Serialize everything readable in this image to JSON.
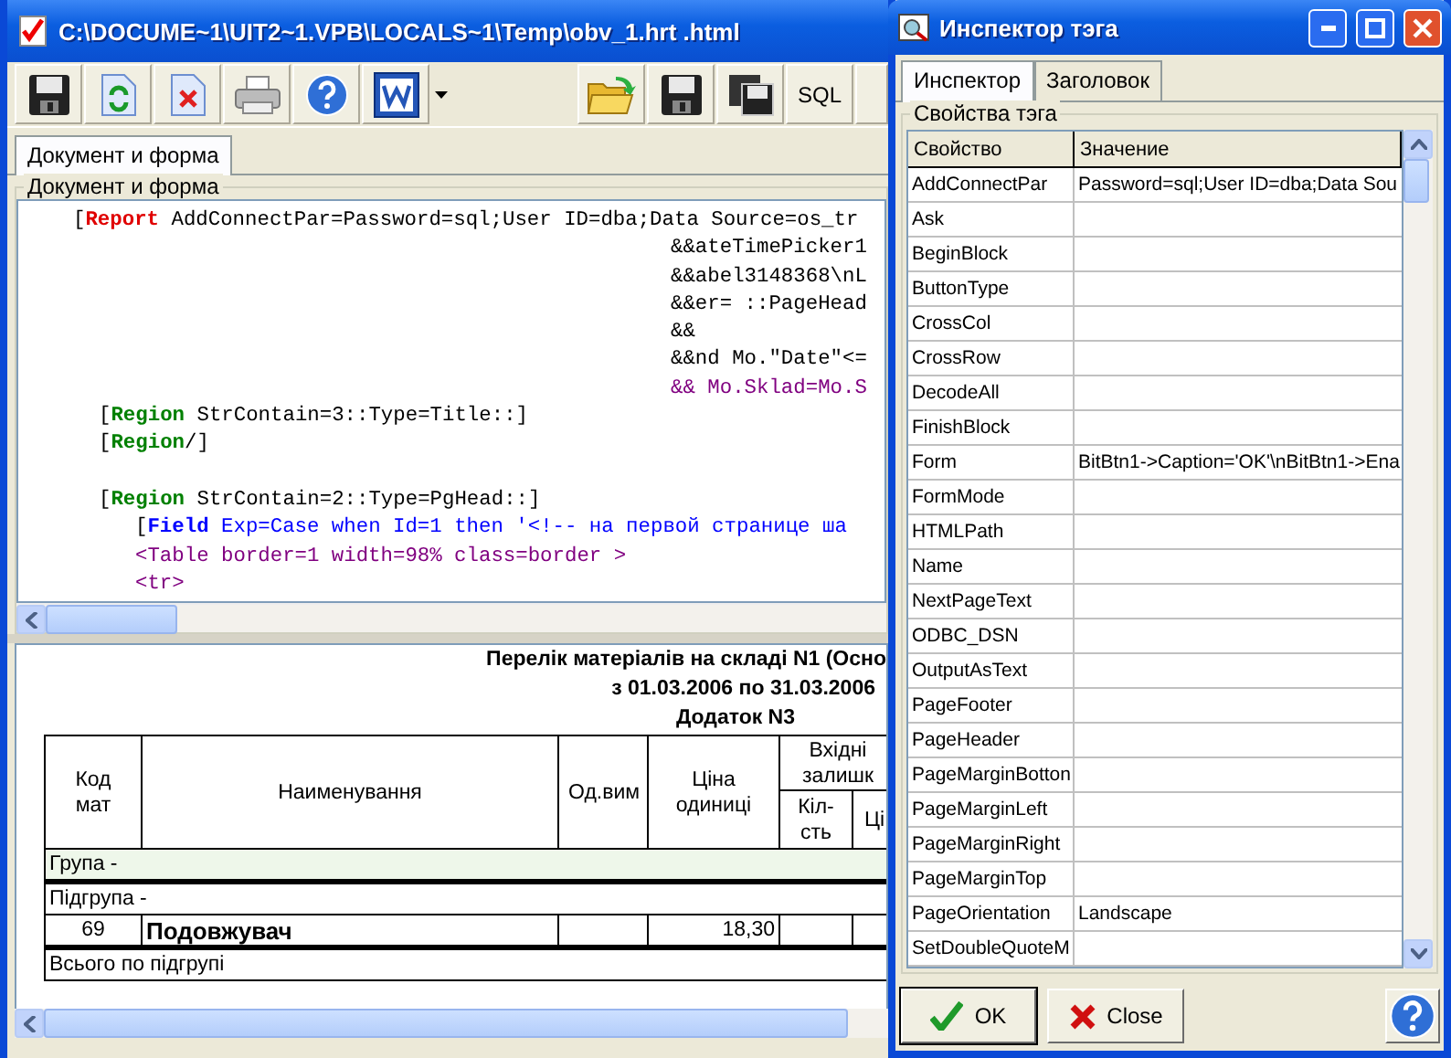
{
  "main_window": {
    "title": "C:\\DOCUME~1\\UIT2~1.VPB\\LOCALS~1\\Temp\\obv_1.hrt .html",
    "toolbar": {
      "sql_label": "SQL"
    },
    "tabs": [
      {
        "label": "Документ и форма",
        "selected": true
      }
    ],
    "editor": {
      "group_label": "Документ и форма",
      "lines": [
        {
          "kind": "report",
          "tag": "[Report",
          "text": " AddConnectPar=Password=sql;User ID=dba;Data Source=os_tr"
        },
        {
          "kind": "cont",
          "text": "&&ateTimePicker1"
        },
        {
          "kind": "cont",
          "text": "&&abel3148368\\nL"
        },
        {
          "kind": "cont",
          "text": "&&er= ::PageHead"
        },
        {
          "kind": "cont",
          "text": "&&"
        },
        {
          "kind": "cont",
          "text": "&&nd Mo.\"Date\"<="
        },
        {
          "kind": "cont_html",
          "text": "&& Mo.Sklad=Mo.S"
        },
        {
          "kind": "region",
          "tag": "[Region",
          "text": " StrContain=3::Type=Title::]"
        },
        {
          "kind": "region",
          "tag": "[Region",
          "text": "/]"
        },
        {
          "kind": "blank"
        },
        {
          "kind": "region",
          "tag": "[Region",
          "text": " StrContain=2::Type=PgHead::]"
        },
        {
          "kind": "field",
          "tag": "[Field",
          "text": " Exp=Case when Id=1 then '<!-- на первой страницe ша"
        },
        {
          "kind": "html",
          "text": "<Table border=1 width=98% class=border >"
        },
        {
          "kind": "html",
          "text": "<tr>"
        }
      ]
    },
    "report": {
      "title_lines": [
        "Перелік матеріалів на складі N1 (Осно",
        "з 01.03.2006 по 31.03.2006",
        "Додаток N3"
      ],
      "columns": [
        {
          "label": "Код мат"
        },
        {
          "label": "Наименування"
        },
        {
          "label": "Од.вим"
        },
        {
          "label": "Ціна одиниці"
        },
        {
          "label": "Вхідні залишк",
          "children": [
            {
              "label": "Кіл-сть"
            },
            {
              "label": "Ці"
            }
          ]
        }
      ],
      "rows": [
        {
          "kind": "group",
          "text": "Група -"
        },
        {
          "kind": "subgroup",
          "text": "Підгрупа -"
        },
        {
          "kind": "item",
          "code": "69",
          "name": "Подовжувач",
          "price": "18,30"
        },
        {
          "kind": "total",
          "text": "Всього по підгрупі"
        }
      ]
    }
  },
  "inspector": {
    "title": "Инспектор тэга",
    "tabs": [
      {
        "label": "Инспектор",
        "selected": true
      },
      {
        "label": "Заголовок",
        "selected": false
      }
    ],
    "group_label": "Свойства тэга",
    "columns": [
      "Свойство",
      "Значение"
    ],
    "rows": [
      {
        "property": "AddConnectPar",
        "value": "Password=sql;User ID=dba;Data Sou"
      },
      {
        "property": "Ask"
      },
      {
        "property": "BeginBlock"
      },
      {
        "property": "ButtonType"
      },
      {
        "property": "CrossCol"
      },
      {
        "property": "CrossRow"
      },
      {
        "property": "DecodeAll"
      },
      {
        "property": "FinishBlock"
      },
      {
        "property": "Form",
        "value": "BitBtn1->Caption='OK'\\nBitBtn1->Ena"
      },
      {
        "property": "FormMode"
      },
      {
        "property": "HTMLPath"
      },
      {
        "property": "Name"
      },
      {
        "property": "NextPageText"
      },
      {
        "property": "ODBC_DSN"
      },
      {
        "property": "OutputAsText"
      },
      {
        "property": "PageFooter"
      },
      {
        "property": "PageHeader"
      },
      {
        "property": "PageMarginBotton"
      },
      {
        "property": "PageMarginLeft"
      },
      {
        "property": "PageMarginRight"
      },
      {
        "property": "PageMarginTop"
      },
      {
        "property": "PageOrientation",
        "value": "Landscape"
      },
      {
        "property": "SetDoubleQuoteM"
      }
    ],
    "buttons": [
      {
        "kind": "ok",
        "label": "OK"
      },
      {
        "kind": "close",
        "label": "Close"
      },
      {
        "kind": "help"
      }
    ]
  }
}
